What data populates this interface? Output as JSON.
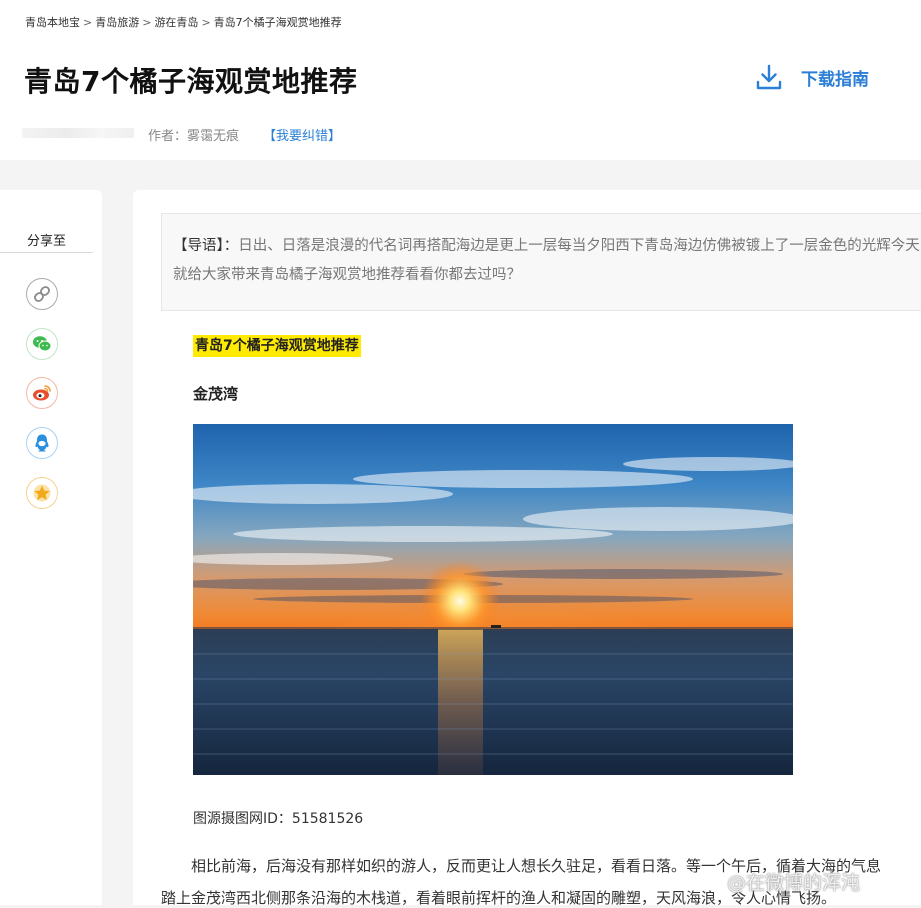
{
  "breadcrumb": {
    "items": [
      "青岛本地宝",
      "青岛旅游",
      "游在青岛",
      "青岛7个橘子海观赏地推荐"
    ],
    "separator": ">"
  },
  "article": {
    "title": "青岛7个橘子海观赏地推荐",
    "author": "作者：雾霭无痕",
    "correction_link": "【我要纠错】"
  },
  "download": {
    "label": "下载指南",
    "icon": "download-icon"
  },
  "share": {
    "title": "分享至",
    "buttons": [
      {
        "name": "link",
        "icon": "link-icon",
        "color": "#999999"
      },
      {
        "name": "wechat",
        "icon": "wechat-icon",
        "color": "#3dbb4f"
      },
      {
        "name": "weibo",
        "icon": "weibo-icon",
        "color": "#e6502d"
      },
      {
        "name": "qq",
        "icon": "qq-icon",
        "color": "#2b8fe0"
      },
      {
        "name": "qzone",
        "icon": "qzone-star-icon",
        "color": "#f2a91b"
      }
    ]
  },
  "intro": {
    "label": "【导语】：",
    "text": "日出、日落是浪漫的代名词再搭配海边是更上一层每当夕阳西下青岛海边仿佛被镀上了一层金色的光辉今天就给大家带来青岛橘子海观赏地推荐看看你都去过吗？"
  },
  "body": {
    "highlight_title": "青岛7个橘子海观赏地推荐",
    "section_heading": "金茂湾",
    "photo_credit": "图源摄图网ID：51581526",
    "paragraph_line1": "　　相比前海，后海没有那样如织的游人，反而更让人想长久驻足，看看日落。等一个午后，循着大海的气息",
    "paragraph_line2": "踏上金茂湾西北侧那条沿海的木栈道，看着眼前挥杆的渔人和凝固的雕塑，天风海浪，令人心情飞扬。"
  },
  "watermark": "@在微博的浑沌",
  "colors": {
    "accent_blue": "#2b7fd6",
    "highlight_yellow": "#ffea00",
    "page_bg": "#f4f4f4"
  }
}
